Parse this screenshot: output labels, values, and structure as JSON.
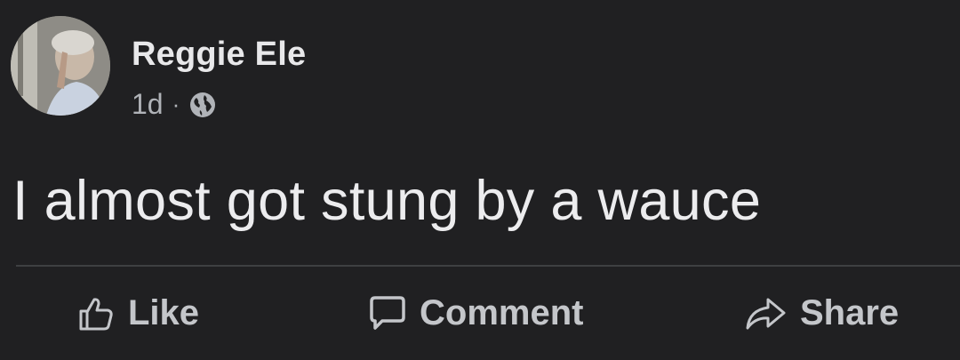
{
  "post": {
    "author": "Reggie Ele",
    "time": "1d",
    "separator": "·",
    "privacy_icon": "globe-icon",
    "message": "I almost got stung by a wauce"
  },
  "actions": {
    "like_label": "Like",
    "comment_label": "Comment",
    "share_label": "Share"
  },
  "colors": {
    "background": "#202022",
    "text": "#e4e6eb",
    "muted": "#b0b3b8",
    "divider": "#3e4042"
  }
}
